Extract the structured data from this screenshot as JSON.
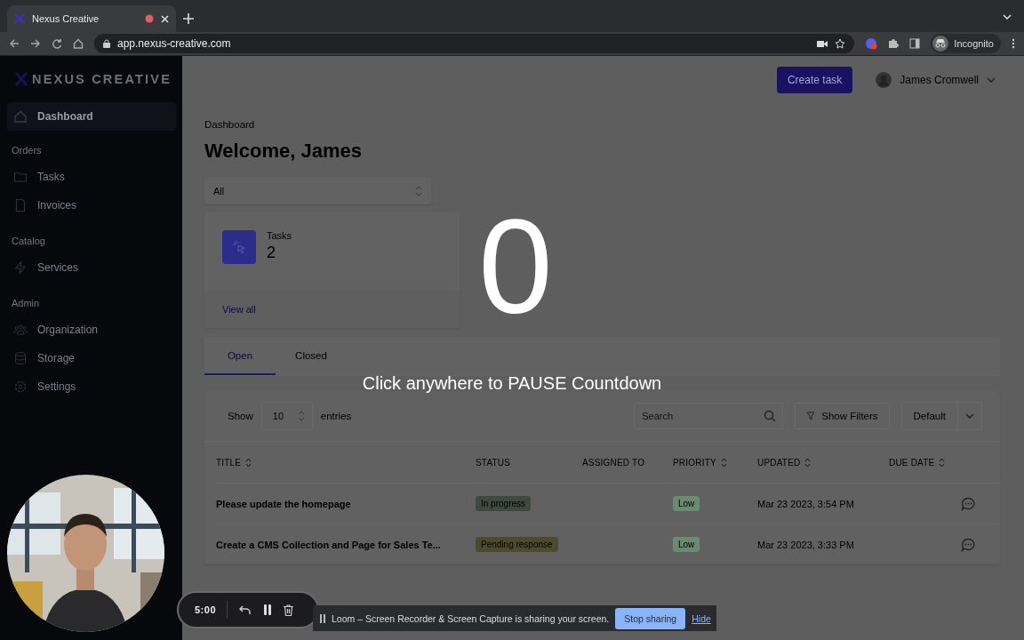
{
  "browser": {
    "tab_title": "Nexus Creative",
    "url": "app.nexus-creative.com",
    "profile": "Incognito"
  },
  "sidebar": {
    "logo": "NEXUS CREATIVE",
    "sections": [
      {
        "items": [
          {
            "label": "Dashboard",
            "selected": true
          }
        ]
      },
      {
        "heading": "Orders",
        "items": [
          {
            "label": "Tasks",
            "selected": false
          },
          {
            "label": "Invoices",
            "selected": false
          }
        ]
      },
      {
        "heading": "Catalog",
        "items": [
          {
            "label": "Services",
            "selected": false
          }
        ]
      },
      {
        "heading": "Admin",
        "items": [
          {
            "label": "Organization",
            "selected": false
          },
          {
            "label": "Storage",
            "selected": false
          },
          {
            "label": "Settings",
            "selected": false
          }
        ]
      }
    ]
  },
  "header": {
    "create_button": "Create task",
    "user_name": "James Cromwell"
  },
  "breadcrumb": "Dashboard",
  "heading": "Welcome, James",
  "filter": {
    "value": "All"
  },
  "stat_card": {
    "label": "Tasks",
    "value": "2",
    "link": "View all"
  },
  "tabs": [
    {
      "label": "Open",
      "selected": true
    },
    {
      "label": "Closed",
      "selected": false
    }
  ],
  "table_controls": {
    "show_label": "Show",
    "page_size": "10",
    "entries_label": "entries",
    "search_placeholder": "Search",
    "filters_button": "Show Filters",
    "view": "Default"
  },
  "table": {
    "columns": [
      {
        "label": "TITLE",
        "sortable": true
      },
      {
        "label": "STATUS",
        "sortable": false
      },
      {
        "label": "ASSIGNED TO",
        "sortable": false
      },
      {
        "label": "PRIORITY",
        "sortable": true
      },
      {
        "label": "UPDATED",
        "sortable": true
      },
      {
        "label": "DUE DATE",
        "sortable": true
      }
    ],
    "rows": [
      {
        "title": "Please update the homepage",
        "status": {
          "label": "In progress",
          "color": "#3c4a40"
        },
        "priority": "Low",
        "updated": "Mar 23 2023, 3:54 PM"
      },
      {
        "title": "Create a CMS Collection and Page for Sales Te...",
        "status": {
          "label": "Pending response",
          "color": "#4e4a2e"
        },
        "priority": "Low",
        "updated": "Mar 23 2023, 3:33 PM"
      }
    ]
  },
  "countdown": {
    "number": "0",
    "hint": "Click anywhere to PAUSE Countdown"
  },
  "recorder": {
    "time": "5:00"
  },
  "share_bar": {
    "message": "Loom – Screen Recorder & Screen Capture is sharing your screen.",
    "stop_button": "Stop sharing",
    "hide_link": "Hide"
  }
}
